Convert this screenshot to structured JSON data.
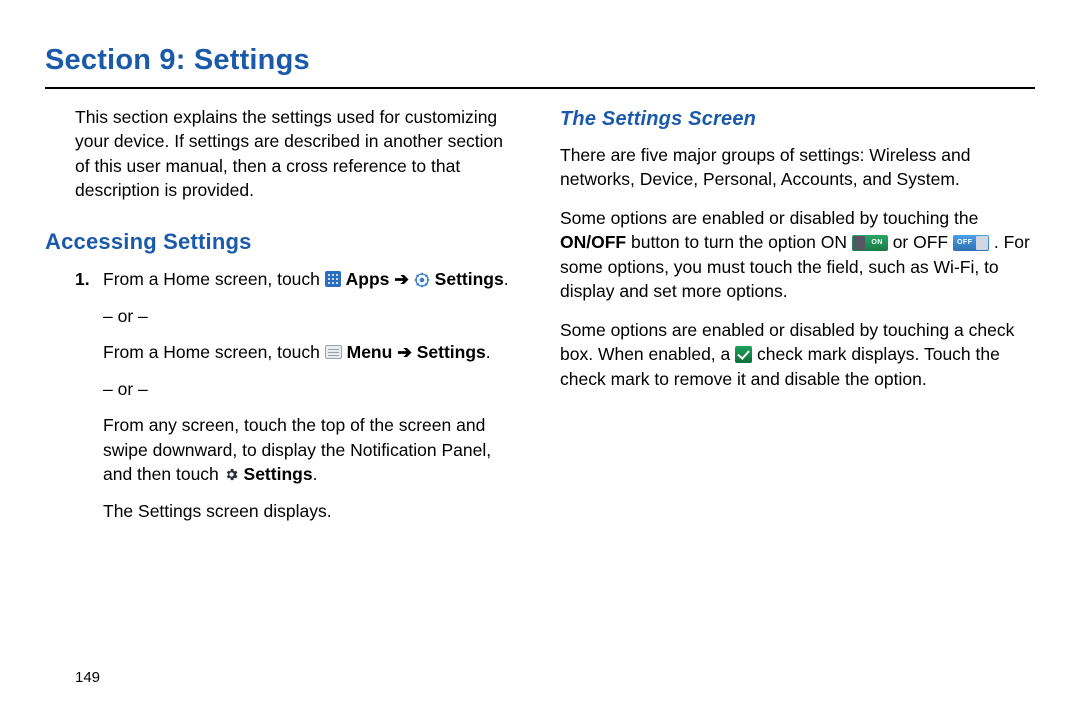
{
  "section_title": "Section 9: Settings",
  "intro": "This section explains the settings used for customizing your device. If settings are described in another section of this user manual, then a cross reference to that description is provided.",
  "left": {
    "heading": "Accessing Settings",
    "step_num": "1.",
    "step1_a": "From a Home screen, touch ",
    "apps_label": " Apps ",
    "arrow": "➔",
    "settings_label_1": " Settings",
    "period": ".",
    "or": "– or –",
    "step1_b": "From a Home screen, touch ",
    "menu_label": " Menu ",
    "settings_label_2": "Settings",
    "step1_c_1": "From any screen, touch the top of the screen and swipe downward, to display the Notification Panel, and then touch ",
    "settings_label_3": " Settings",
    "result": "The Settings screen displays."
  },
  "right": {
    "heading": "The Settings Screen",
    "p1": "There are five major groups of settings: Wireless and networks, Device, Personal, Accounts, and System.",
    "p2_a": "Some options are enabled or disabled by touching the ",
    "onoff_bold": "ON/OFF",
    "p2_b": " button to turn the option ON ",
    "p2_c": " or OFF ",
    "p2_d": ". For some options, you must touch the field, such as Wi-Fi, to display and set more options.",
    "p3_a": "Some options are enabled or disabled by touching a check box. When enabled, a ",
    "p3_b": " check mark displays. Touch the check mark to remove it and disable the option."
  },
  "page_number": "149"
}
